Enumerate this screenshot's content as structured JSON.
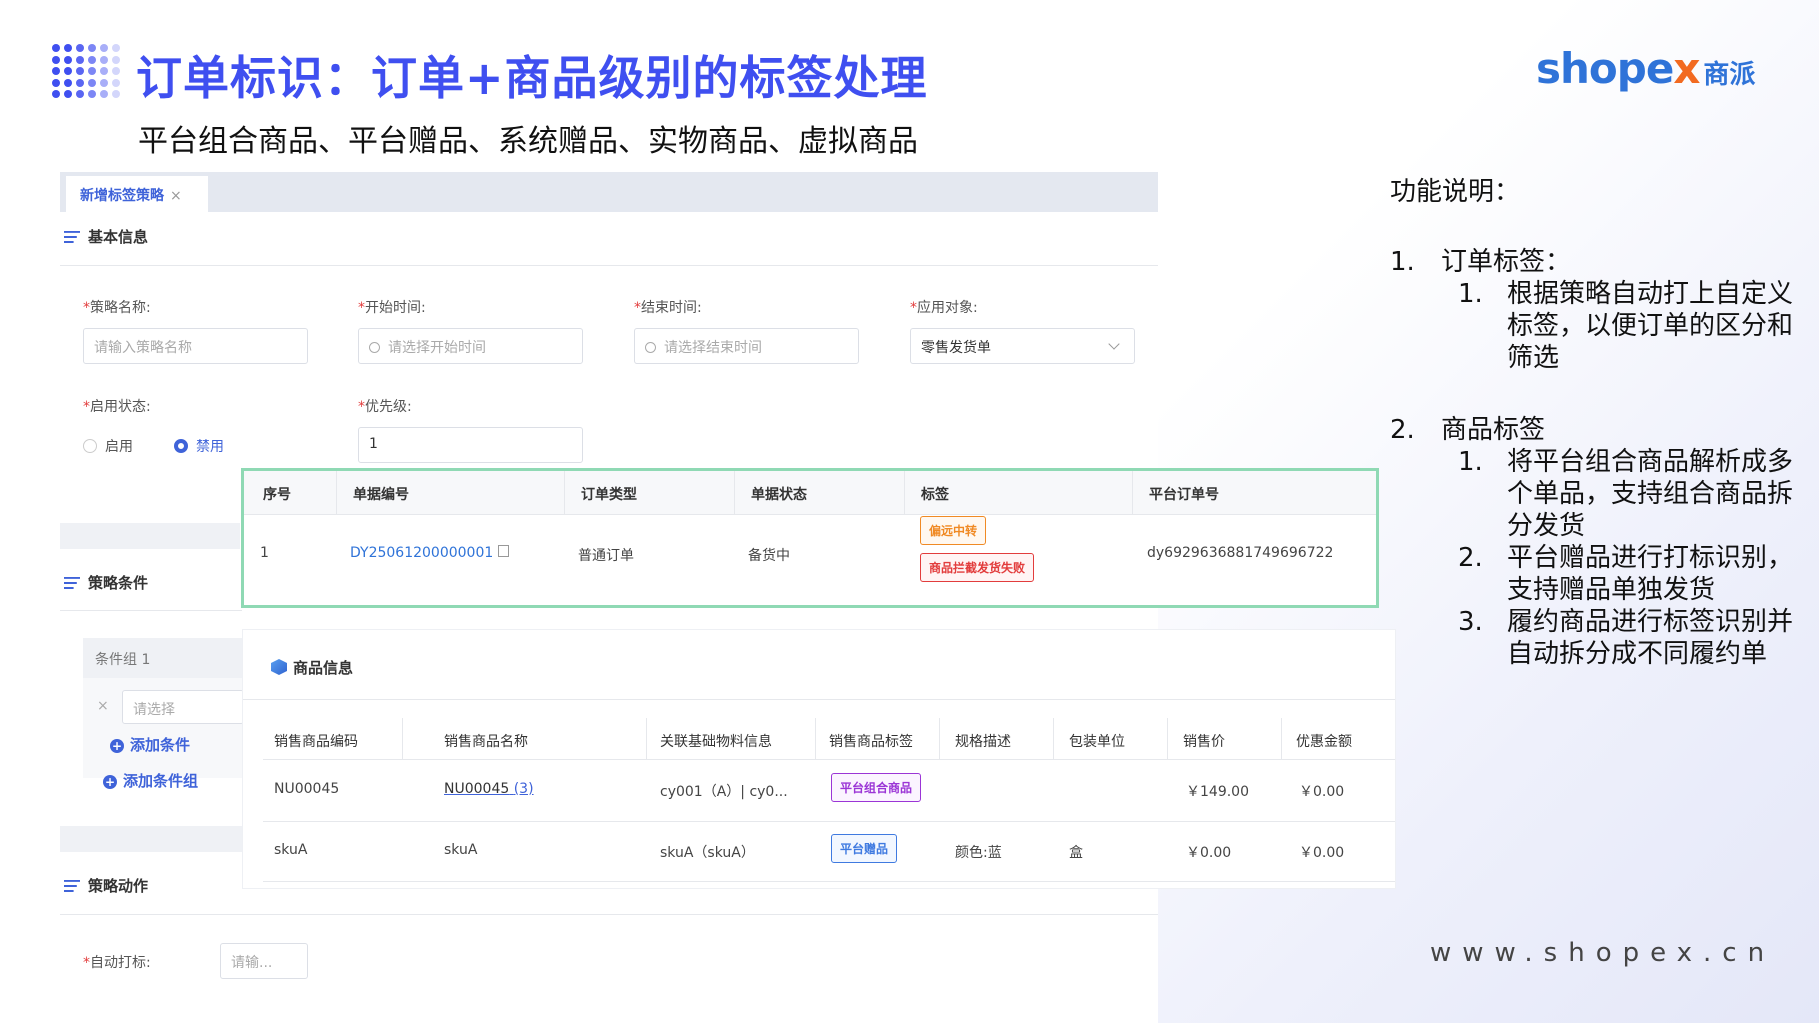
{
  "header": {
    "title": "订单标识：订单+商品级别的标签处理",
    "subtitle": "平台组合商品、平台赠品、系统赠品、实物商品、虚拟商品",
    "logo_text_main": "shope",
    "logo_text_x": "x",
    "logo_text_cn": "商派",
    "colors": {
      "title": "#3f4ff0",
      "logo_blue": "#2f73d8",
      "logo_orange": "#f26a21"
    }
  },
  "app": {
    "tab": {
      "label": "新增标签策略",
      "close": "×"
    },
    "basic_info": {
      "heading": "基本信息",
      "fields": [
        {
          "label": "策略名称:",
          "placeholder": "请输入策略名称"
        },
        {
          "label": "开始时间:",
          "placeholder": "请选择开始时间"
        },
        {
          "label": "结束时间:",
          "placeholder": "请选择结束时间"
        },
        {
          "label": "应用对象:",
          "value": "零售发货单"
        }
      ],
      "status_label": "启用状态:",
      "status_options": [
        "启用",
        "禁用"
      ],
      "status_selected": "禁用",
      "priority_label": "优先级:",
      "priority_value": "1"
    },
    "conditions": {
      "heading": "策略条件",
      "group_label": "条件组 1",
      "select_placeholder": "请选择",
      "remove": "×",
      "add_condition": "添加条件",
      "add_group": "添加条件组"
    },
    "actions": {
      "heading": "策略动作",
      "auto_tag_label": "自动打标:",
      "auto_tag_placeholder": "请输..."
    }
  },
  "order_table": {
    "columns": [
      "序号",
      "单据编号",
      "订单类型",
      "单据状态",
      "标签",
      "平台订单号"
    ],
    "row": {
      "index": "1",
      "doc_no": "DY25061200000001",
      "order_type": "普通订单",
      "status": "备货中",
      "tags": [
        "偏远中转",
        "商品拦截发货失败"
      ],
      "platform_order_no": "dy6929636881749696722"
    }
  },
  "product_info": {
    "heading": "商品信息",
    "columns": [
      "销售商品编码",
      "销售商品名称",
      "关联基础物料信息",
      "销售商品标签",
      "规格描述",
      "包装单位",
      "销售价",
      "优惠金额"
    ],
    "rows": [
      {
        "code": "NU00045",
        "name": "NU00045",
        "name_count": "(3)",
        "material": "cy001（A）| cy0...",
        "tag": "平台组合商品",
        "spec": "",
        "unit": "",
        "price": "￥149.00",
        "discount": "￥0.00"
      },
      {
        "code": "skuA",
        "name": "skuA",
        "name_count": "",
        "material": "skuA（skuA）",
        "tag": "平台赠品",
        "spec": "颜色:蓝",
        "unit": "盒",
        "price": "￥0.00",
        "discount": "￥0.00"
      }
    ]
  },
  "notes": {
    "title": "功能说明：",
    "sections": [
      {
        "num": "1.",
        "title": "订单标签：",
        "items": [
          {
            "num": "1.",
            "text": "根据策略自动打上自定义标签，以便订单的区分和筛选"
          }
        ]
      },
      {
        "num": "2.",
        "title": "商品标签",
        "items": [
          {
            "num": "1.",
            "text": "将平台组合商品解析成多个单品，支持组合商品拆分发货"
          },
          {
            "num": "2.",
            "text": "平台赠品进行打标识别，支持赠品单独发货"
          },
          {
            "num": "3.",
            "text": "履约商品进行标签识别并自动拆分成不同履约单"
          }
        ]
      }
    ]
  },
  "footer": {
    "website": "www.shopex.cn"
  }
}
